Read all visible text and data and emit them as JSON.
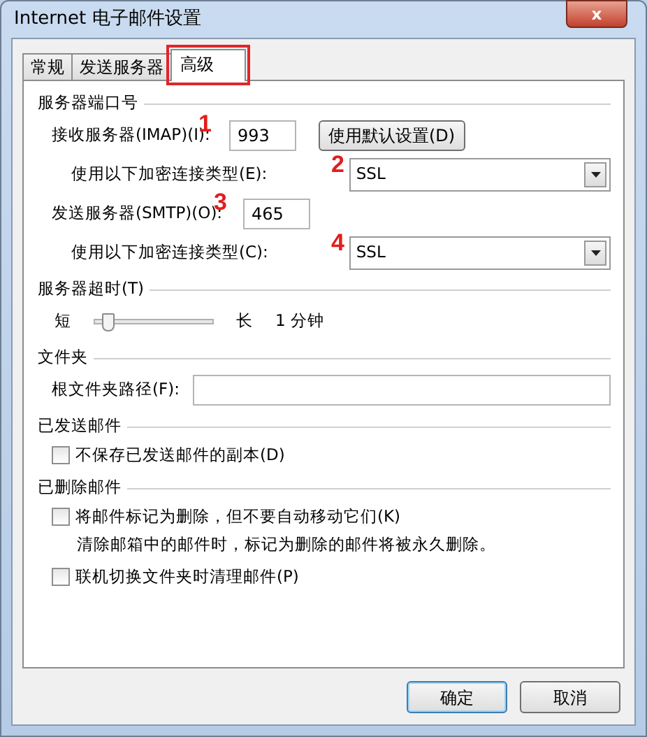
{
  "window": {
    "title": "Internet 电子邮件设置",
    "close": "x"
  },
  "tabs": [
    {
      "label": "常规",
      "selected": false,
      "highlighted": false
    },
    {
      "label": "发送服务器",
      "selected": false,
      "highlighted": false
    },
    {
      "label": "高级",
      "selected": true,
      "highlighted": true
    }
  ],
  "port_section": {
    "title": "服务器端口号",
    "incoming": {
      "label": "接收服务器(IMAP)(I):",
      "value": "993",
      "marker": "1"
    },
    "default_button": "使用默认设置(D)",
    "incoming_encryption": {
      "label": "使用以下加密连接类型(E):",
      "value": "SSL",
      "marker": "2"
    },
    "outgoing": {
      "label": "发送服务器(SMTP)(O):",
      "value": "465",
      "marker": "3"
    },
    "outgoing_encryption": {
      "label": "使用以下加密连接类型(C):",
      "value": "SSL",
      "marker": "4"
    }
  },
  "timeout_section": {
    "title": "服务器超时(T)",
    "min_label": "短",
    "max_label": "长",
    "level": 0.06,
    "reading": "1 分钟"
  },
  "folders_section": {
    "title": "文件夹",
    "root_label": "根文件夹路径(F):"
  },
  "sent_section": {
    "title": "已发送邮件",
    "options": [
      {
        "label": "不保存已发送邮件的副本(D)",
        "checked": false
      }
    ]
  },
  "deleted_section": {
    "title": "已删除邮件",
    "options": [
      {
        "label": "将邮件标记为删除，但不要自动移动它们(K)",
        "checked": false,
        "note": "清除邮箱中的邮件时，标记为删除的邮件将被永久删除。"
      },
      {
        "label": "联机切换文件夹时清理邮件(P)",
        "checked": false
      }
    ]
  },
  "buttons": [
    {
      "label": "确定",
      "default": true
    },
    {
      "label": "取消",
      "default": false
    }
  ]
}
